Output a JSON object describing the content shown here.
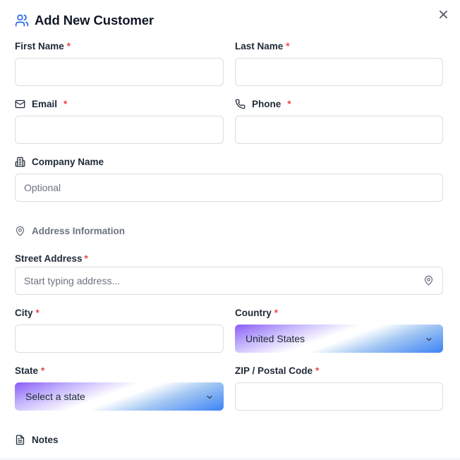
{
  "modal": {
    "title": "Add New Customer"
  },
  "fields": {
    "first_name": {
      "label": "First Name",
      "required_mark": "*",
      "value": ""
    },
    "last_name": {
      "label": "Last Name",
      "required_mark": "*",
      "value": ""
    },
    "email": {
      "label": "Email",
      "required_mark": "*",
      "value": ""
    },
    "phone": {
      "label": "Phone",
      "required_mark": "*",
      "value": ""
    },
    "company": {
      "label": "Company Name",
      "placeholder": "Optional",
      "value": ""
    },
    "street": {
      "label": "Street Address",
      "required_mark": "*",
      "placeholder": "Start typing address...",
      "value": ""
    },
    "city": {
      "label": "City",
      "required_mark": "*",
      "value": ""
    },
    "country": {
      "label": "Country",
      "required_mark": "*",
      "selected": "United States"
    },
    "state": {
      "label": "State",
      "required_mark": "*",
      "selected": "Select a state"
    },
    "zip": {
      "label": "ZIP / Postal Code",
      "required_mark": "*",
      "value": ""
    }
  },
  "sections": {
    "address_title": "Address Information",
    "notes_label": "Notes"
  },
  "icons": {
    "header": "users-icon",
    "close": "close-icon",
    "email": "mail-icon",
    "phone": "phone-icon",
    "company": "building-icon",
    "address": "map-pin-icon",
    "street": "map-pin-icon",
    "dropdown": "chevron-down-icon",
    "notes": "file-text-icon"
  },
  "colors": {
    "accent": "#2563eb",
    "required": "#ef4444",
    "border": "#d9dde3",
    "muted": "#6b7280"
  }
}
